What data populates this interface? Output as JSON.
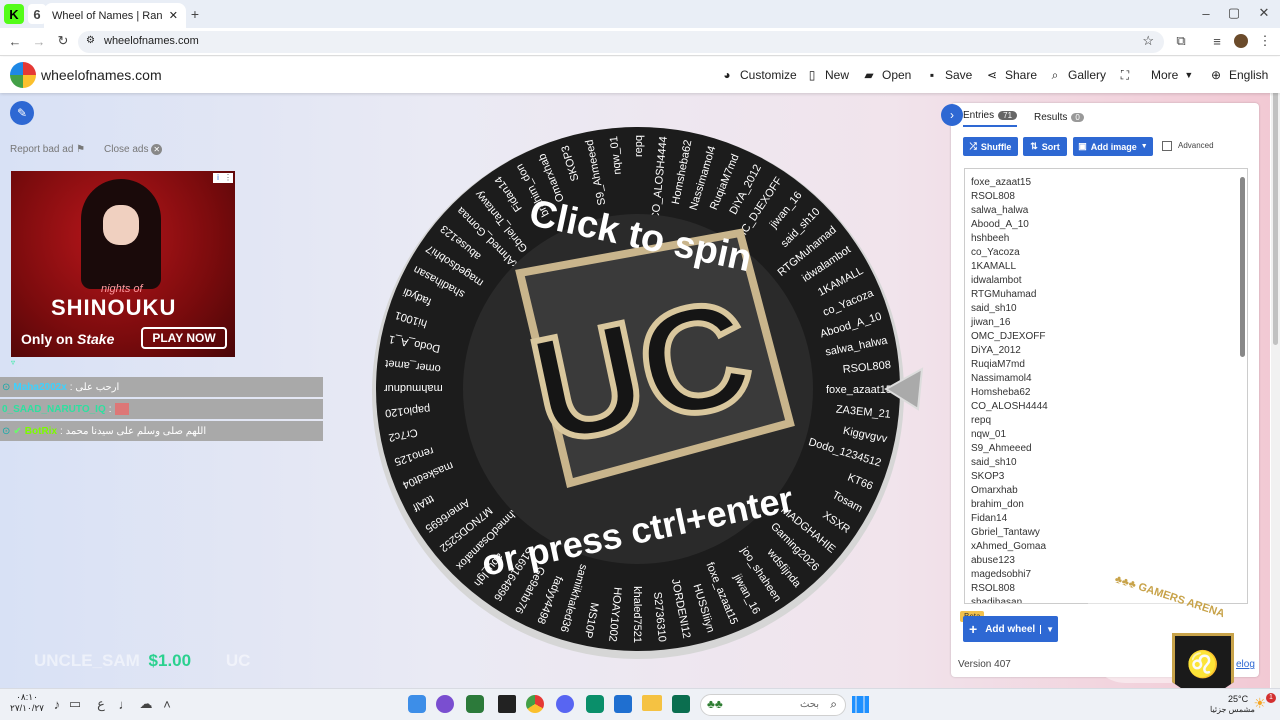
{
  "browser": {
    "tab_title": "Wheel of Names | Random nam",
    "url": "wheelofnames.com",
    "new_tab": "+"
  },
  "header": {
    "logo_text": "wheelofnames.com",
    "items": [
      "Customize",
      "New",
      "Open",
      "Save",
      "Share",
      "Gallery",
      "",
      "More",
      "English"
    ]
  },
  "left": {
    "report_ad": "Report bad ad",
    "close_ads": "Close ads",
    "ad": {
      "title_line1": "nights of",
      "title_line2": "SHINOUKU",
      "left_text": "Only on",
      "brand": "Stake",
      "cta": "PLAY NOW"
    },
    "chat": [
      {
        "user": "Maha2002x",
        "msg": ": ارحب على"
      },
      {
        "user": "0_SAAD_NARUTO_IQ",
        "msg": ":"
      },
      {
        "user": "BotRix",
        "msg": ": اللهم صلى وسلم على سيدنا محمد"
      }
    ],
    "overlay": {
      "faded_text": "UNCLE_SAM",
      "amount": "$1.00",
      "unit": "UC"
    }
  },
  "wheel": {
    "top_text": "Click to spin",
    "bottom_text": "or press ctrl+enter",
    "badge": "UC",
    "labels": [
      "foxe_azaat15",
      "RSOL808",
      "salwa_halwa",
      "Abood_A_10",
      "co_Yacoza",
      "1KAMALL",
      "idwalambot",
      "RTGMuhamad",
      "said_sh10",
      "jiwan_16",
      "OMC_DJEXOFF",
      "DiYA_2012",
      "RuqiaM7md",
      "Nassimamol4",
      "Homsheba62",
      "CO_ALOSH4444",
      "repq",
      "nqw_01",
      "S9_Ahmeeed",
      "SKOP3",
      "Omarxhab",
      "brahim_don",
      "Fidan14",
      "Gbriel_Tantawy",
      "xAhmed_Gomaa",
      "abuse123",
      "magedsobhi7",
      "shadihasan",
      "fadydi",
      "hi1001",
      "Dodo_A_1",
      "omer_amet",
      "mahmudnur",
      "paplo120",
      "Cr7c2",
      "reno125",
      "maskedt04",
      "tttAlf",
      "Amer6695",
      "M7NOD5252",
      "AhmedOsamafox",
      "abu_lgh",
      "S169164896",
      "Ge9ahb76",
      "fadyy4498",
      "samiikhaled36",
      "MS10P",
      "HOAY1002",
      "khaled7521",
      "S2736310",
      "JORDENI12",
      "HUSSIiiyn",
      "foxe_azaat15",
      "jiwan_16",
      "joo_shaheen",
      "wdsfijnda",
      "Gaming2026",
      "MADGHAHIE",
      "XSXR",
      "Tosam",
      "KT66",
      "Dodo_1234512",
      "Kiggvgvv",
      "ZA3EM_21"
    ]
  },
  "panel": {
    "tab_entries": "Entries",
    "entries_count": "71",
    "tab_results": "Results",
    "results_count": "0",
    "shuffle": "Shuffle",
    "sort": "Sort",
    "add_image": "Add image",
    "advanced": "Advanced",
    "beta": "Beta",
    "add_wheel": "Add wheel",
    "version": "Version 407",
    "changelog": "elog",
    "entries": [
      "foxe_azaat15",
      "RSOL808",
      "salwa_halwa",
      "Abood_A_10",
      "hshbeeh",
      "co_Yacoza",
      "1KAMALL",
      "idwalambot",
      "RTGMuhamad",
      "said_sh10",
      "jiwan_16",
      "OMC_DJEXOFF",
      "DiYA_2012",
      "RuqiaM7md",
      "Nassimamol4",
      "Homsheba62",
      "CO_ALOSH4444",
      "repq",
      "nqw_01",
      "S9_Ahmeeed",
      "said_sh10",
      "SKOP3",
      "Omarxhab",
      "brahim_don",
      "Fidan14",
      "Gbriel_Tantawy",
      "xAhmed_Gomaa",
      "abuse123",
      "magedsobhi7",
      "RSOL808",
      "shadihasan"
    ]
  },
  "taskbar": {
    "time": "٠٨:١٠",
    "date": "٢٧/١٠/٢٧",
    "weather_temp": "25°C",
    "weather_desc": "مشمس جزئيا",
    "search_placeholder": "بحث",
    "lang": "ع",
    "notif": "1"
  },
  "colors": {
    "accent": "#2e68d3",
    "wheel_dark": "#1c1c1c"
  }
}
